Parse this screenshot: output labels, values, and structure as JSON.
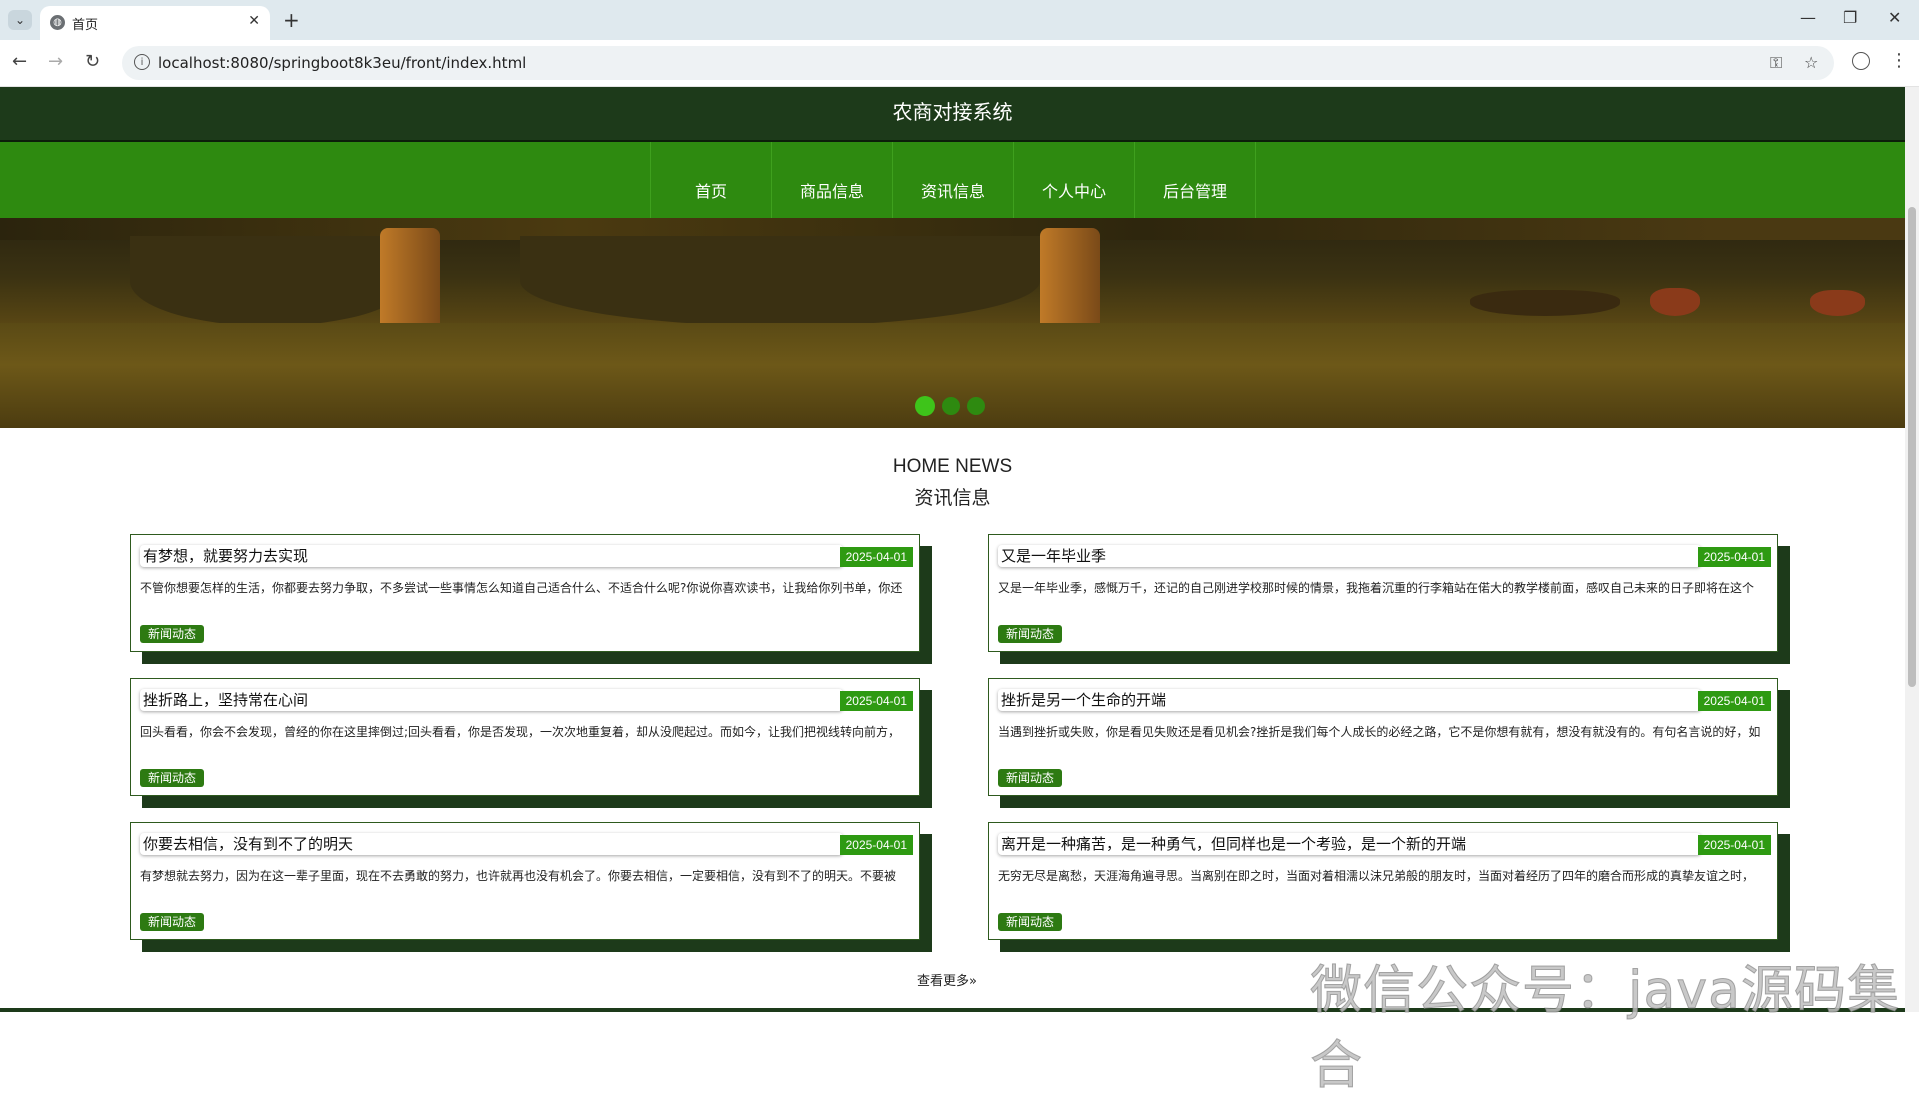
{
  "browser": {
    "tab_title": "首页",
    "url": "localhost:8080/springboot8k3eu/front/index.html"
  },
  "site": {
    "title": "农商对接系统",
    "nav": [
      "首页",
      "商品信息",
      "资讯信息",
      "个人中心",
      "后台管理"
    ]
  },
  "carousel": {
    "slide_count": 3,
    "active_index": 0
  },
  "news_section": {
    "title_en": "HOME NEWS",
    "title_cn": "资讯信息",
    "items": [
      {
        "title": "有梦想，就要努力去实现",
        "date": "2025-04-01",
        "summary": "不管你想要怎样的生活，你都要去努力争取，不多尝试一些事情怎么知道自己适合什么、不适合什么呢?你说你喜欢读书，让我给你列书单，你还",
        "tag": "新闻动态"
      },
      {
        "title": "又是一年毕业季",
        "date": "2025-04-01",
        "summary": "又是一年毕业季，感慨万千，还记的自己刚进学校那时候的情景，我拖着沉重的行李箱站在偌大的教学楼前面，感叹自己未来的日子即将在这个",
        "tag": "新闻动态"
      },
      {
        "title": "挫折路上，坚持常在心间",
        "date": "2025-04-01",
        "summary": "回头看看，你会不会发现，曾经的你在这里摔倒过;回头看看，你是否发现，一次次地重复着，却从没爬起过。而如今，让我们把视线转向前方，",
        "tag": "新闻动态"
      },
      {
        "title": "挫折是另一个生命的开端",
        "date": "2025-04-01",
        "summary": "当遇到挫折或失败，你是看见失败还是看见机会?挫折是我们每个人成长的必经之路，它不是你想有就有，想没有就没有的。有句名言说的好，如",
        "tag": "新闻动态"
      },
      {
        "title": "你要去相信，没有到不了的明天",
        "date": "2025-04-01",
        "summary": "有梦想就去努力，因为在这一辈子里面，现在不去勇敢的努力，也许就再也没有机会了。你要去相信，一定要相信，没有到不了的明天。不要被",
        "tag": "新闻动态"
      },
      {
        "title": "离开是一种痛苦，是一种勇气，但同样也是一个考验，是一个新的开端",
        "date": "2025-04-01",
        "summary": "无穷无尽是离愁，天涯海角遍寻思。当离别在即之时，当面对着相濡以沫兄弟般的朋友时，当面对着经历了四年的磨合而形成的真挚友谊之时，",
        "tag": "新闻动态"
      }
    ],
    "more_label": "查看更多»"
  },
  "watermark": "微信公众号：java源码集合"
}
